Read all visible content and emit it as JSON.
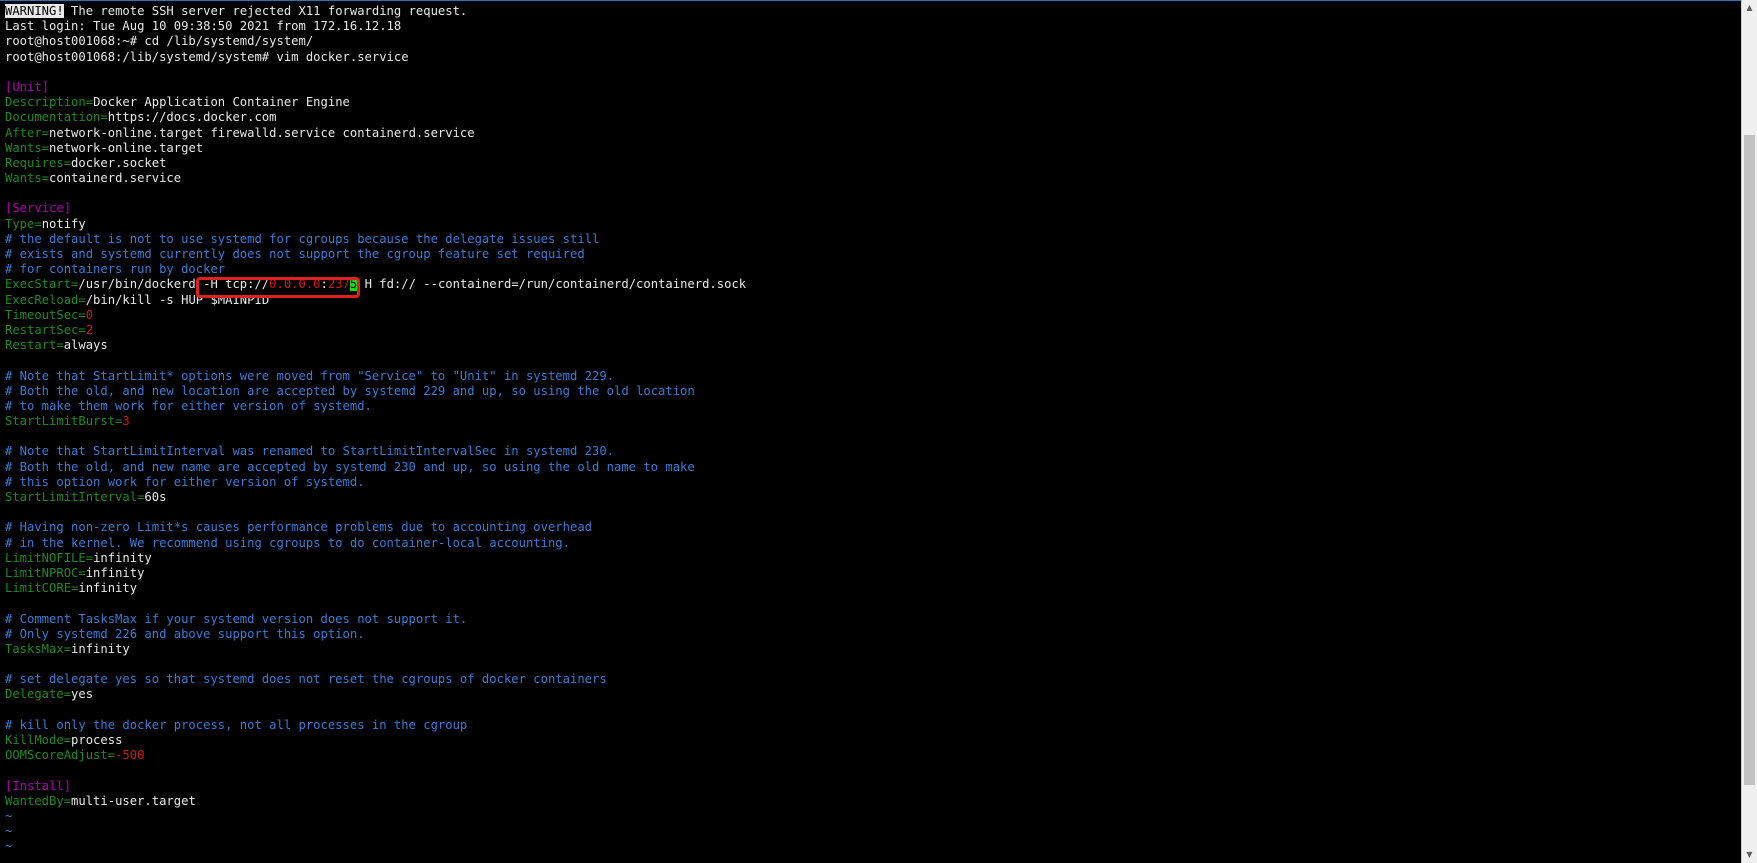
{
  "terminal": {
    "lines": [
      [
        {
          "t": "WARNING!",
          "c": "inv"
        },
        {
          "t": " The remote SSH server rejected X11 forwarding request.",
          "c": "default"
        }
      ],
      [
        {
          "t": "Last login: Tue Aug 10 09:38:50 2021 from 172.16.12.18",
          "c": "default"
        }
      ],
      [
        {
          "t": "root@host001068:~# cd /lib/systemd/system/",
          "c": "default"
        }
      ],
      [
        {
          "t": "root@host001068:/lib/systemd/system# vim docker.service",
          "c": "default"
        }
      ],
      [],
      [
        {
          "t": "[Unit]",
          "c": "section"
        }
      ],
      [
        {
          "t": "Description=",
          "c": "key"
        },
        {
          "t": "Docker Application Container Engine",
          "c": "default"
        }
      ],
      [
        {
          "t": "Documentation=",
          "c": "key"
        },
        {
          "t": "https://docs.docker.com",
          "c": "default"
        }
      ],
      [
        {
          "t": "After=",
          "c": "key"
        },
        {
          "t": "network-online.target firewalld.service containerd.service",
          "c": "default"
        }
      ],
      [
        {
          "t": "Wants=",
          "c": "key"
        },
        {
          "t": "network-online.target",
          "c": "default"
        }
      ],
      [
        {
          "t": "Requires=",
          "c": "key"
        },
        {
          "t": "docker.socket",
          "c": "default"
        }
      ],
      [
        {
          "t": "Wants=",
          "c": "key"
        },
        {
          "t": "containerd.service",
          "c": "default"
        }
      ],
      [],
      [
        {
          "t": "[Service]",
          "c": "section"
        }
      ],
      [
        {
          "t": "Type=",
          "c": "key"
        },
        {
          "t": "notify",
          "c": "default"
        }
      ],
      [
        {
          "t": "# the default is not to use systemd for cgroups because the delegate issues still",
          "c": "comment"
        }
      ],
      [
        {
          "t": "# exists and systemd currently does not support the cgroup feature set required",
          "c": "comment"
        }
      ],
      [
        {
          "t": "# for containers run by docker",
          "c": "comment"
        }
      ],
      [
        {
          "t": "ExecStart=",
          "c": "key"
        },
        {
          "t": "/usr/bin/dockerd -H tcp://",
          "c": "default"
        },
        {
          "t": "0.0.0.0",
          "c": "red"
        },
        {
          "t": ":",
          "c": "default"
        },
        {
          "t": "237",
          "c": "red"
        },
        {
          "t": "5",
          "c": "cur"
        },
        {
          "t": " H fd:// --containerd=/run/containerd/containerd.sock",
          "c": "default"
        }
      ],
      [
        {
          "t": "ExecReload=",
          "c": "key"
        },
        {
          "t": "/bin/kill -s HUP $MAINPID",
          "c": "default"
        }
      ],
      [
        {
          "t": "TimeoutSec=",
          "c": "key"
        },
        {
          "t": "0",
          "c": "red"
        }
      ],
      [
        {
          "t": "RestartSec=",
          "c": "key"
        },
        {
          "t": "2",
          "c": "red"
        }
      ],
      [
        {
          "t": "Restart=",
          "c": "key"
        },
        {
          "t": "always",
          "c": "default"
        }
      ],
      [],
      [
        {
          "t": "# Note that StartLimit* options were moved from \"Service\" to \"Unit\" in systemd 229.",
          "c": "comment"
        }
      ],
      [
        {
          "t": "# Both the old, and new location are accepted by systemd 229 and up, so using the old location",
          "c": "comment"
        }
      ],
      [
        {
          "t": "# to make them work for either version of systemd.",
          "c": "comment"
        }
      ],
      [
        {
          "t": "StartLimitBurst=",
          "c": "key"
        },
        {
          "t": "3",
          "c": "red"
        }
      ],
      [],
      [
        {
          "t": "# Note that StartLimitInterval was renamed to StartLimitIntervalSec in systemd 230.",
          "c": "comment"
        }
      ],
      [
        {
          "t": "# Both the old, and new name are accepted by systemd 230 and up, so using the old name to make",
          "c": "comment"
        }
      ],
      [
        {
          "t": "# this option work for either version of systemd.",
          "c": "comment"
        }
      ],
      [
        {
          "t": "StartLimitInterval=",
          "c": "key"
        },
        {
          "t": "60s",
          "c": "default"
        }
      ],
      [],
      [
        {
          "t": "# Having non-zero Limit*s causes performance problems due to accounting overhead",
          "c": "comment"
        }
      ],
      [
        {
          "t": "# in the kernel. We recommend using cgroups to do container-local accounting.",
          "c": "comment"
        }
      ],
      [
        {
          "t": "LimitNOFILE=",
          "c": "key"
        },
        {
          "t": "infinity",
          "c": "default"
        }
      ],
      [
        {
          "t": "LimitNPROC=",
          "c": "key"
        },
        {
          "t": "infinity",
          "c": "default"
        }
      ],
      [
        {
          "t": "LimitCORE=",
          "c": "key"
        },
        {
          "t": "infinity",
          "c": "default"
        }
      ],
      [],
      [
        {
          "t": "# Comment TasksMax if your systemd version does not support it.",
          "c": "comment"
        }
      ],
      [
        {
          "t": "# Only systemd 226 and above support this option.",
          "c": "comment"
        }
      ],
      [
        {
          "t": "TasksMax=",
          "c": "key"
        },
        {
          "t": "infinity",
          "c": "default"
        }
      ],
      [],
      [
        {
          "t": "# set delegate yes so that systemd does not reset the cgroups of docker containers",
          "c": "comment"
        }
      ],
      [
        {
          "t": "Delegate=",
          "c": "key"
        },
        {
          "t": "yes",
          "c": "default"
        }
      ],
      [],
      [
        {
          "t": "# kill only the docker process, not all processes in the cgroup",
          "c": "comment"
        }
      ],
      [
        {
          "t": "KillMode=",
          "c": "key"
        },
        {
          "t": "process",
          "c": "default"
        }
      ],
      [
        {
          "t": "OOMScoreAdjust=",
          "c": "key"
        },
        {
          "t": "-500",
          "c": "red"
        }
      ],
      [],
      [
        {
          "t": "[Install]",
          "c": "section"
        }
      ],
      [
        {
          "t": "WantedBy=",
          "c": "key"
        },
        {
          "t": "multi-user.target",
          "c": "default"
        }
      ],
      [
        {
          "t": "~",
          "c": "tilde"
        }
      ],
      [
        {
          "t": "~",
          "c": "tilde"
        }
      ],
      [
        {
          "t": "~",
          "c": "tilde"
        }
      ]
    ]
  },
  "scrollbar": {
    "up_icon": "▲",
    "down_icon": "▼"
  },
  "colors": {
    "background": "#000000",
    "text": "#e8e8e8",
    "key": "#1f8a1f",
    "section": "#b000b0",
    "comment": "#3a7bd5",
    "value_red": "#d01818",
    "cursor": "#19d819",
    "annotation_box": "#e0201d"
  }
}
